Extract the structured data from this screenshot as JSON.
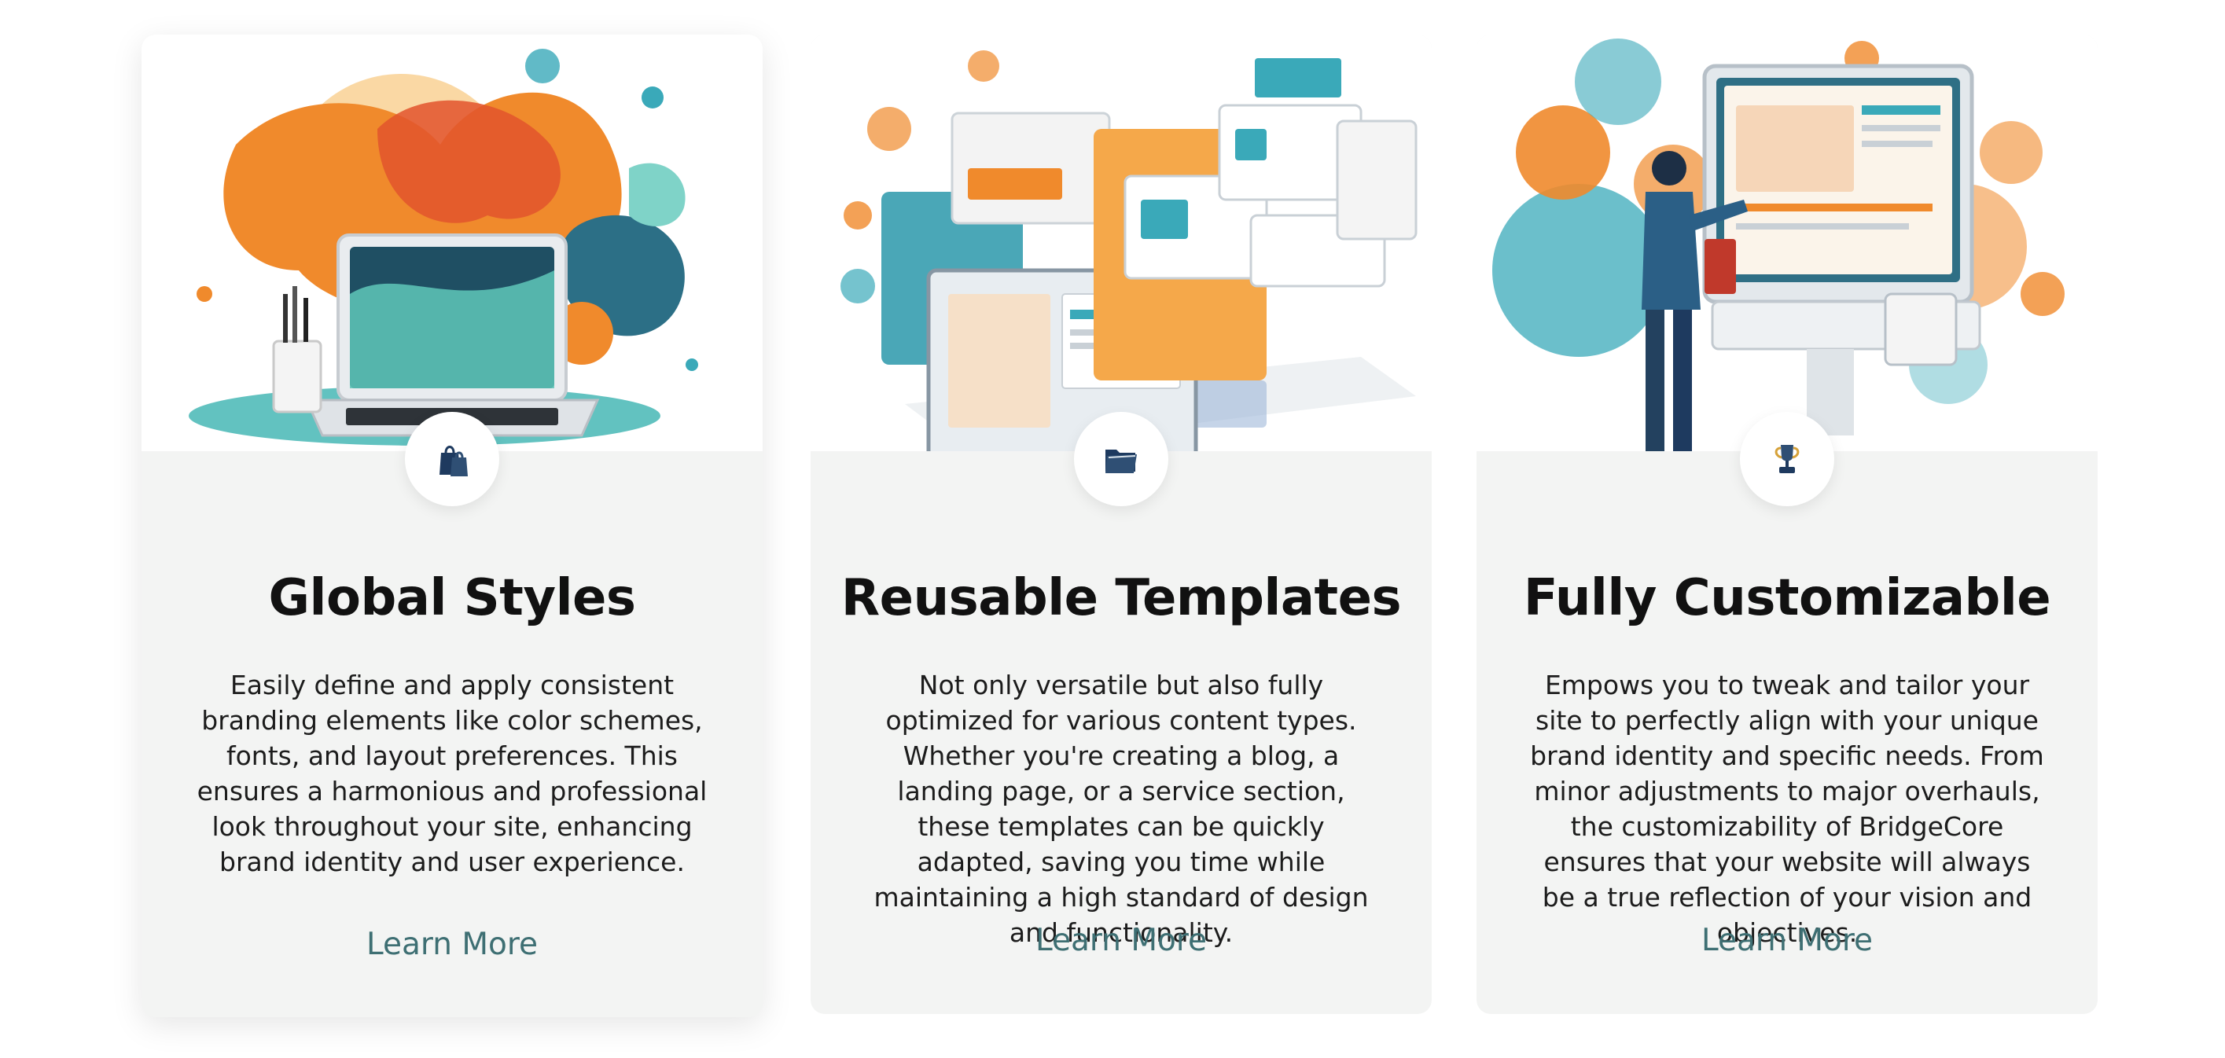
{
  "colors": {
    "card_bg": "#f3f4f3",
    "link": "#3e6f73",
    "orange": "#f08a2c",
    "teal": "#3aa9b9",
    "navy": "#1e3a5f"
  },
  "cards": [
    {
      "title": "Global Styles",
      "description": "Easily define and apply consistent branding elements like color schemes, fonts, and layout preferences. This ensures a harmonious and professional look throughout your site, enhancing brand identity and user experience.",
      "link_label": "Learn More",
      "icon": "shopping-bags-icon",
      "image": "laptop-paint-splash-illustration"
    },
    {
      "title": "Reusable Templates",
      "description": "Not only versatile but also fully optimized for various content types. Whether you're creating a blog, a landing page, or a service section, these templates can be quickly adapted, saving you time while maintaining a high standard of design and functionality.",
      "link_label": "Learn More",
      "icon": "folder-icon",
      "image": "layered-web-templates-illustration"
    },
    {
      "title": "Fully Customizable",
      "description": "Empows you to tweak and tailor your site to perfectly align with your unique brand identity and specific needs. From minor adjustments to major overhauls, the customizability of BridgeCore ensures that your website will always be a true reflection of your vision and objectives.",
      "link_label": "Learn More",
      "icon": "trophy-icon",
      "image": "person-at-monitor-illustration"
    }
  ]
}
